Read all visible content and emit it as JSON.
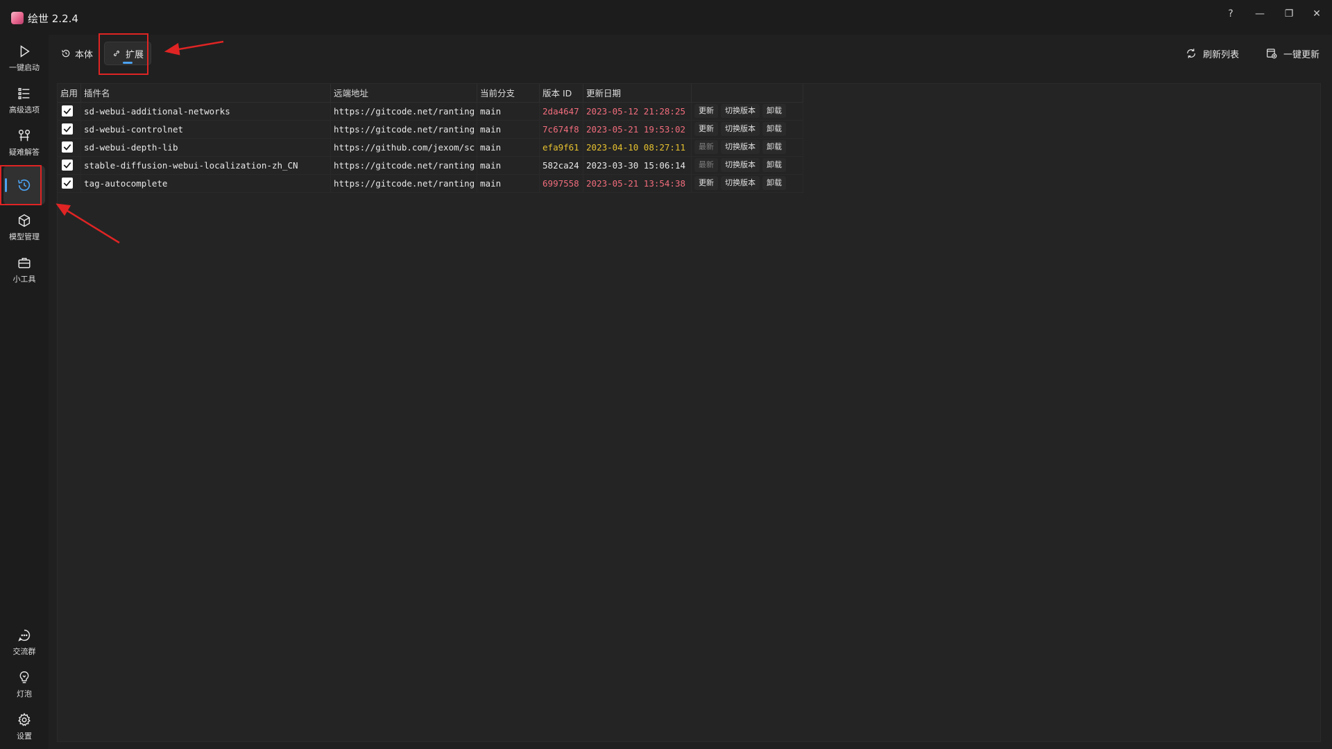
{
  "app": {
    "title": "绘世 2.2.4"
  },
  "window_controls": {
    "help": "?",
    "minimize": "—",
    "restore": "❐",
    "close": "✕"
  },
  "sidebar": {
    "items": [
      {
        "label": "一键启动",
        "icon": "play-icon"
      },
      {
        "label": "高级选项",
        "icon": "list-icon"
      },
      {
        "label": "疑难解答",
        "icon": "wrench-icon"
      },
      {
        "label": "",
        "icon": "history-icon",
        "active": true
      },
      {
        "label": "模型管理",
        "icon": "cube-icon"
      },
      {
        "label": "小工具",
        "icon": "toolbox-icon"
      }
    ],
    "bottom_items": [
      {
        "label": "交流群",
        "icon": "chat-icon"
      },
      {
        "label": "灯泡",
        "icon": "bulb-icon"
      },
      {
        "label": "设置",
        "icon": "gear-icon"
      }
    ]
  },
  "tabs": [
    {
      "label": "本体",
      "icon": "history-icon"
    },
    {
      "label": "扩展",
      "icon": "link-icon",
      "active": true
    }
  ],
  "actions": {
    "refresh": "刷新列表",
    "update_all": "一键更新"
  },
  "table": {
    "headers": [
      "启用",
      "插件名",
      "远端地址",
      "当前分支",
      "版本 ID",
      "更新日期"
    ],
    "rows": [
      {
        "enabled": true,
        "name": "sd-webui-additional-networks",
        "remote": "https://gitcode.net/ranting",
        "branch": "main",
        "version": "2da4647",
        "date": "2023-05-12 21:28:25",
        "status": "red",
        "update": "更新",
        "update_disabled": false,
        "switch": "切换版本",
        "uninstall": "卸载"
      },
      {
        "enabled": true,
        "name": "sd-webui-controlnet",
        "remote": "https://gitcode.net/ranting",
        "branch": "main",
        "version": "7c674f8",
        "date": "2023-05-21 19:53:02",
        "status": "red",
        "update": "更新",
        "update_disabled": false,
        "switch": "切换版本",
        "uninstall": "卸载"
      },
      {
        "enabled": true,
        "name": "sd-webui-depth-lib",
        "remote": "https://github.com/jexom/sc",
        "branch": "main",
        "version": "efa9f61",
        "date": "2023-04-10 08:27:11",
        "status": "yellow",
        "update": "最新",
        "update_disabled": true,
        "switch": "切换版本",
        "uninstall": "卸载"
      },
      {
        "enabled": true,
        "name": "stable-diffusion-webui-localization-zh_CN",
        "remote": "https://gitcode.net/ranting",
        "branch": "main",
        "version": "582ca24",
        "date": "2023-03-30 15:06:14",
        "status": "normal",
        "update": "最新",
        "update_disabled": true,
        "switch": "切换版本",
        "uninstall": "卸载"
      },
      {
        "enabled": true,
        "name": "tag-autocomplete",
        "remote": "https://gitcode.net/ranting",
        "branch": "main",
        "version": "6997558",
        "date": "2023-05-21 13:54:38",
        "status": "red",
        "update": "更新",
        "update_disabled": false,
        "switch": "切换版本",
        "uninstall": "卸载"
      }
    ]
  },
  "colors": {
    "accent": "#4ca3f3",
    "status_red": "#f26d7d",
    "status_yellow": "#e6c12f",
    "annotation": "#e02424"
  }
}
